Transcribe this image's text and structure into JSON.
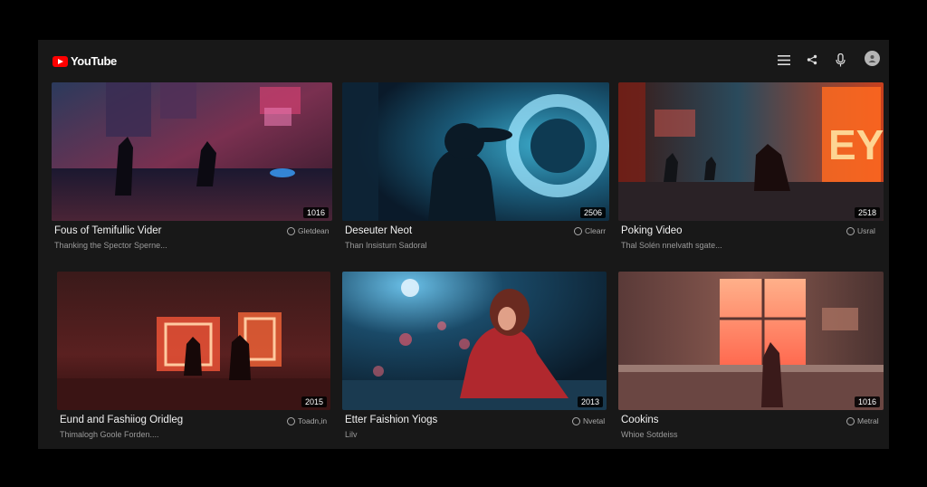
{
  "header": {
    "logo_text": "YouTube",
    "icons": [
      "menu-icon",
      "share-icon",
      "mic-icon",
      "avatar"
    ]
  },
  "videos": [
    {
      "title": "Fous of Temifullic Vider",
      "subtitle": "Thanking the Spector Sperne...",
      "meta": "Gletdean",
      "duration": "1016"
    },
    {
      "title": "Deseuter Neot",
      "subtitle": "Than Insisturn Sadoral",
      "meta": "Clearr",
      "duration": "2506"
    },
    {
      "title": "Poking Video",
      "subtitle": "Thal Solén nnelvath sgate...",
      "meta": "Usral",
      "duration": "2518"
    },
    {
      "title": "Eund and Fashiiog Oridleg",
      "subtitle": "Thimalogh Goole Forden....",
      "meta": "Toadn,in",
      "duration": "2015"
    },
    {
      "title": "Etter Faishion Yiogs",
      "subtitle": "Lilv",
      "meta": "Nvetal",
      "duration": "2013"
    },
    {
      "title": "Cookins",
      "subtitle": "Whioe Sotdeiss",
      "meta": "Metral",
      "duration": "1016"
    }
  ],
  "colors": {
    "background": "#181818",
    "logo_red": "#ff0000",
    "title": "#f1f1f1",
    "subtitle": "#9a9a9a"
  }
}
